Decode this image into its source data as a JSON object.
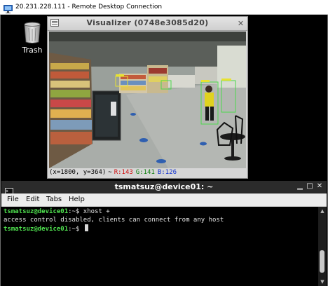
{
  "rdp": {
    "title": "20.231.228.111 - Remote Desktop Connection",
    "icon": "remote-desktop-icon"
  },
  "desktop": {
    "trash_label": "Trash",
    "trash_icon": "trash-icon"
  },
  "visualizer": {
    "title": "Visualizer (0748e3085d20)",
    "menu_icon": "window-menu-icon",
    "close_icon": "close-icon",
    "frame_description_icon": "camera-feed",
    "status": {
      "coords": "(x=1800, y=364)",
      "separator": "~",
      "r": "R:143",
      "g": "G:141",
      "b": "B:126"
    }
  },
  "terminal": {
    "title": "tsmatsuz@device01: ~",
    "menu": [
      "File",
      "Edit",
      "Tabs",
      "Help"
    ],
    "lines": {
      "prompt1": "tsmatsuz@device01",
      "cmd1": ":~$ xhost +",
      "output1": "access control disabled, clients can connect from any host",
      "prompt2": "tsmatsuz@device01",
      "cmd2": ":~$ "
    },
    "colors": {
      "prompt": "#4fe24f",
      "text": "#e5e5e5",
      "background": "#000000"
    }
  },
  "detection_colors": {
    "box_person": "#4cd84c",
    "box_label_bg": "#e8e230",
    "label_text": "#cc1010"
  }
}
